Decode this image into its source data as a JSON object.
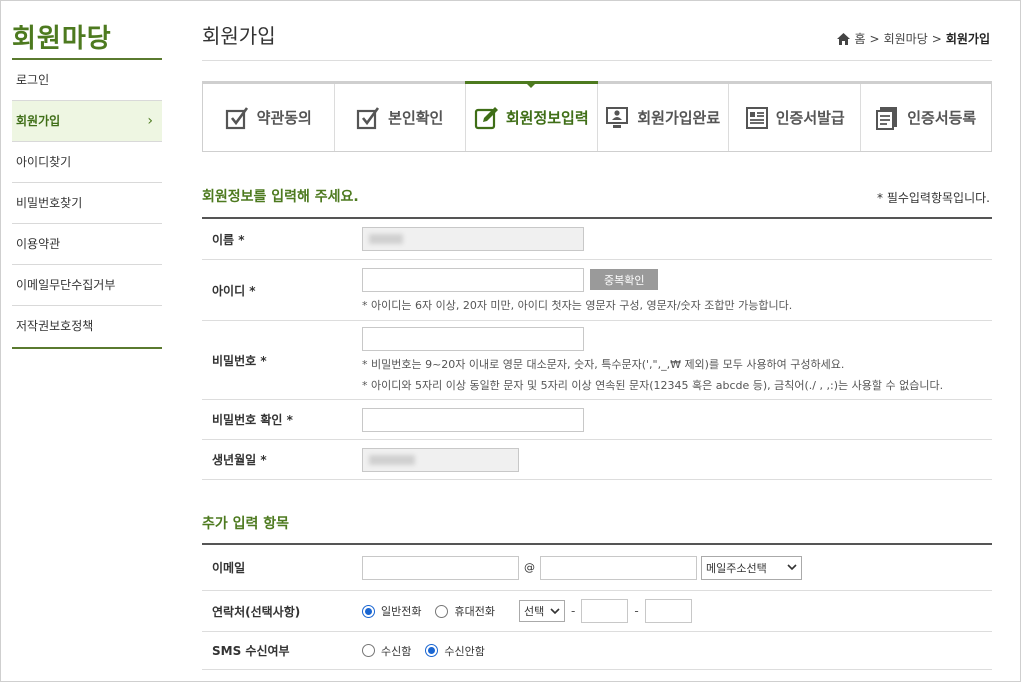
{
  "sidebar": {
    "title": "회원마당",
    "items": [
      {
        "label": "로그인"
      },
      {
        "label": "회원가입",
        "chevron": "›"
      },
      {
        "label": "아이디찾기"
      },
      {
        "label": "비밀번호찾기"
      },
      {
        "label": "이용약관"
      },
      {
        "label": "이메일무단수집거부"
      },
      {
        "label": "저작권보호정책"
      }
    ]
  },
  "header": {
    "title": "회원가입",
    "breadcrumb": {
      "home": "홈",
      "sep1": ">",
      "parent": "회원마당",
      "sep2": ">",
      "current": "회원가입"
    }
  },
  "steps": [
    {
      "label": "약관동의",
      "icon": "checkbox-icon"
    },
    {
      "label": "본인확인",
      "icon": "checkbox-icon"
    },
    {
      "label": "회원정보입력",
      "icon": "edit-icon"
    },
    {
      "label": "회원가입완료",
      "icon": "monitor-user-icon"
    },
    {
      "label": "인증서발급",
      "icon": "certificate-icon"
    },
    {
      "label": "인증서등록",
      "icon": "register-icon"
    }
  ],
  "section1": {
    "title": "회원정보를 입력해 주세요.",
    "required_note": "* 필수입력항목입니다.",
    "name_label": "이름 *",
    "id_label": "아이디 *",
    "id_check_button": "중복확인",
    "id_hint": "* 아이디는 6자 이상, 20자 미만, 아이디 첫자는 영문자 구성, 영문자/숫자 조합만 가능합니다.",
    "pw_label": "비밀번호 *",
    "pw_hint1": "* 비밀번호는 9~20자 이내로 영문 대소문자, 숫자, 특수문자(',\",_,₩ 제외)를 모두 사용하여 구성하세요.",
    "pw_hint2": "* 아이디와 5자리 이상 동일한 문자 및 5자리 이상 연속된 문자(12345 혹은 abcde 등), 금칙어(./ , ,:)는 사용할 수 없습니다.",
    "pw_confirm_label": "비밀번호 확인 *",
    "birth_label": "생년월일 *"
  },
  "section2": {
    "title": "추가 입력 항목",
    "email_label": "이메일",
    "email_at": "@",
    "email_select": "메일주소선택",
    "phone_label": "연락처(선택사항)",
    "phone_opt1": "일반전화",
    "phone_opt2": "휴대전화",
    "phone_select": "선택",
    "phone_dash": "-",
    "sms_label": "SMS 수신여부",
    "sms_opt1": "수신함",
    "sms_opt2": "수신안함"
  },
  "colors": {
    "accent": "#4d7a1f",
    "radio": "#1a66d2"
  }
}
